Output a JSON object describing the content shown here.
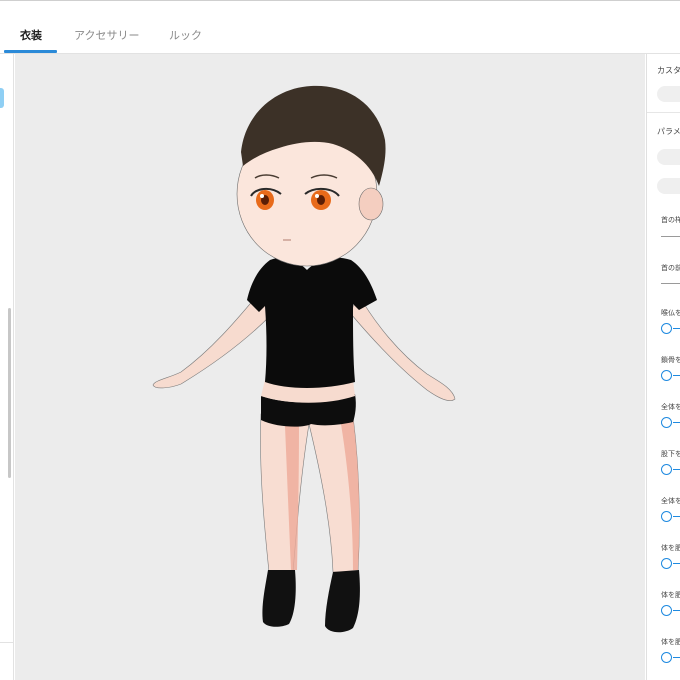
{
  "tabs": [
    {
      "label": "衣装",
      "active": true
    },
    {
      "label": "アクセサリー",
      "active": false
    },
    {
      "label": "ルック",
      "active": false
    }
  ],
  "right_panel": {
    "section1_title": "カスタ",
    "section2_title": "パラメ",
    "fields": [
      {
        "label": "首の样"
      },
      {
        "label": "首の前"
      }
    ],
    "sliders": [
      {
        "label": "喉仏を"
      },
      {
        "label": "鎖骨を"
      },
      {
        "label": "全体を"
      },
      {
        "label": "股下を"
      },
      {
        "label": "全体を"
      },
      {
        "label": "体を肥"
      },
      {
        "label": "体を肥"
      },
      {
        "label": "体を肥"
      }
    ]
  },
  "colors": {
    "accent": "#2b8ad8",
    "viewport_bg": "#ececec",
    "slider": "#1f8ae0"
  }
}
